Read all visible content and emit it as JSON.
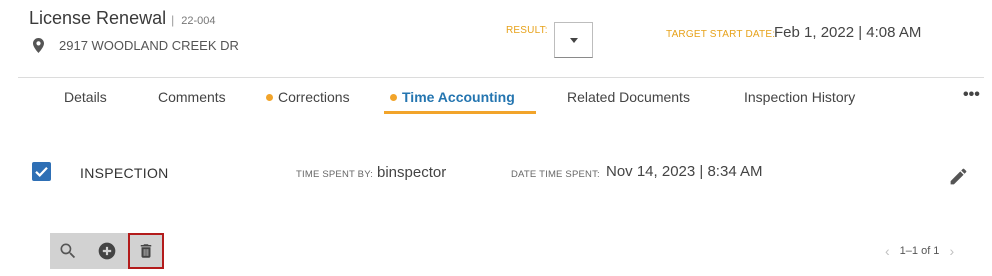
{
  "header": {
    "title": "License Renewal",
    "record_id": "22-004",
    "address": "2917 WOODLAND CREEK DR",
    "result_label": "RESULT:",
    "target_start_label": "TARGET START DATE:",
    "target_start_value": "Feb 1, 2022 | 4:08 AM"
  },
  "tabs": [
    {
      "label": "Details"
    },
    {
      "label": "Comments"
    },
    {
      "label": "Corrections"
    },
    {
      "label": "Time Accounting"
    },
    {
      "label": "Related Documents"
    },
    {
      "label": "Inspection History"
    }
  ],
  "more_label": "•••",
  "row": {
    "type": "INSPECTION",
    "time_spent_by_label": "TIME SPENT BY:",
    "time_spent_by_value": "binspector",
    "date_time_label": "DATE TIME SPENT:",
    "date_time_value": "Nov 14, 2023 | 8:34 AM"
  },
  "pager": {
    "text": "1–1 of 1"
  },
  "colors": {
    "accent_orange": "#f2a42a",
    "active_blue": "#2475b0",
    "checkbox_blue": "#2e6fb5",
    "highlight_red": "#b31b1b"
  },
  "icons": {
    "location": "location-pin-icon",
    "dropdown": "caret-down-icon",
    "more": "more-horizontal-icon",
    "checkbox": "checkmark-icon",
    "edit": "pencil-icon",
    "search": "search-icon",
    "add": "add-circle-icon",
    "delete": "trash-icon",
    "prev": "chevron-left-icon",
    "next": "chevron-right-icon"
  }
}
